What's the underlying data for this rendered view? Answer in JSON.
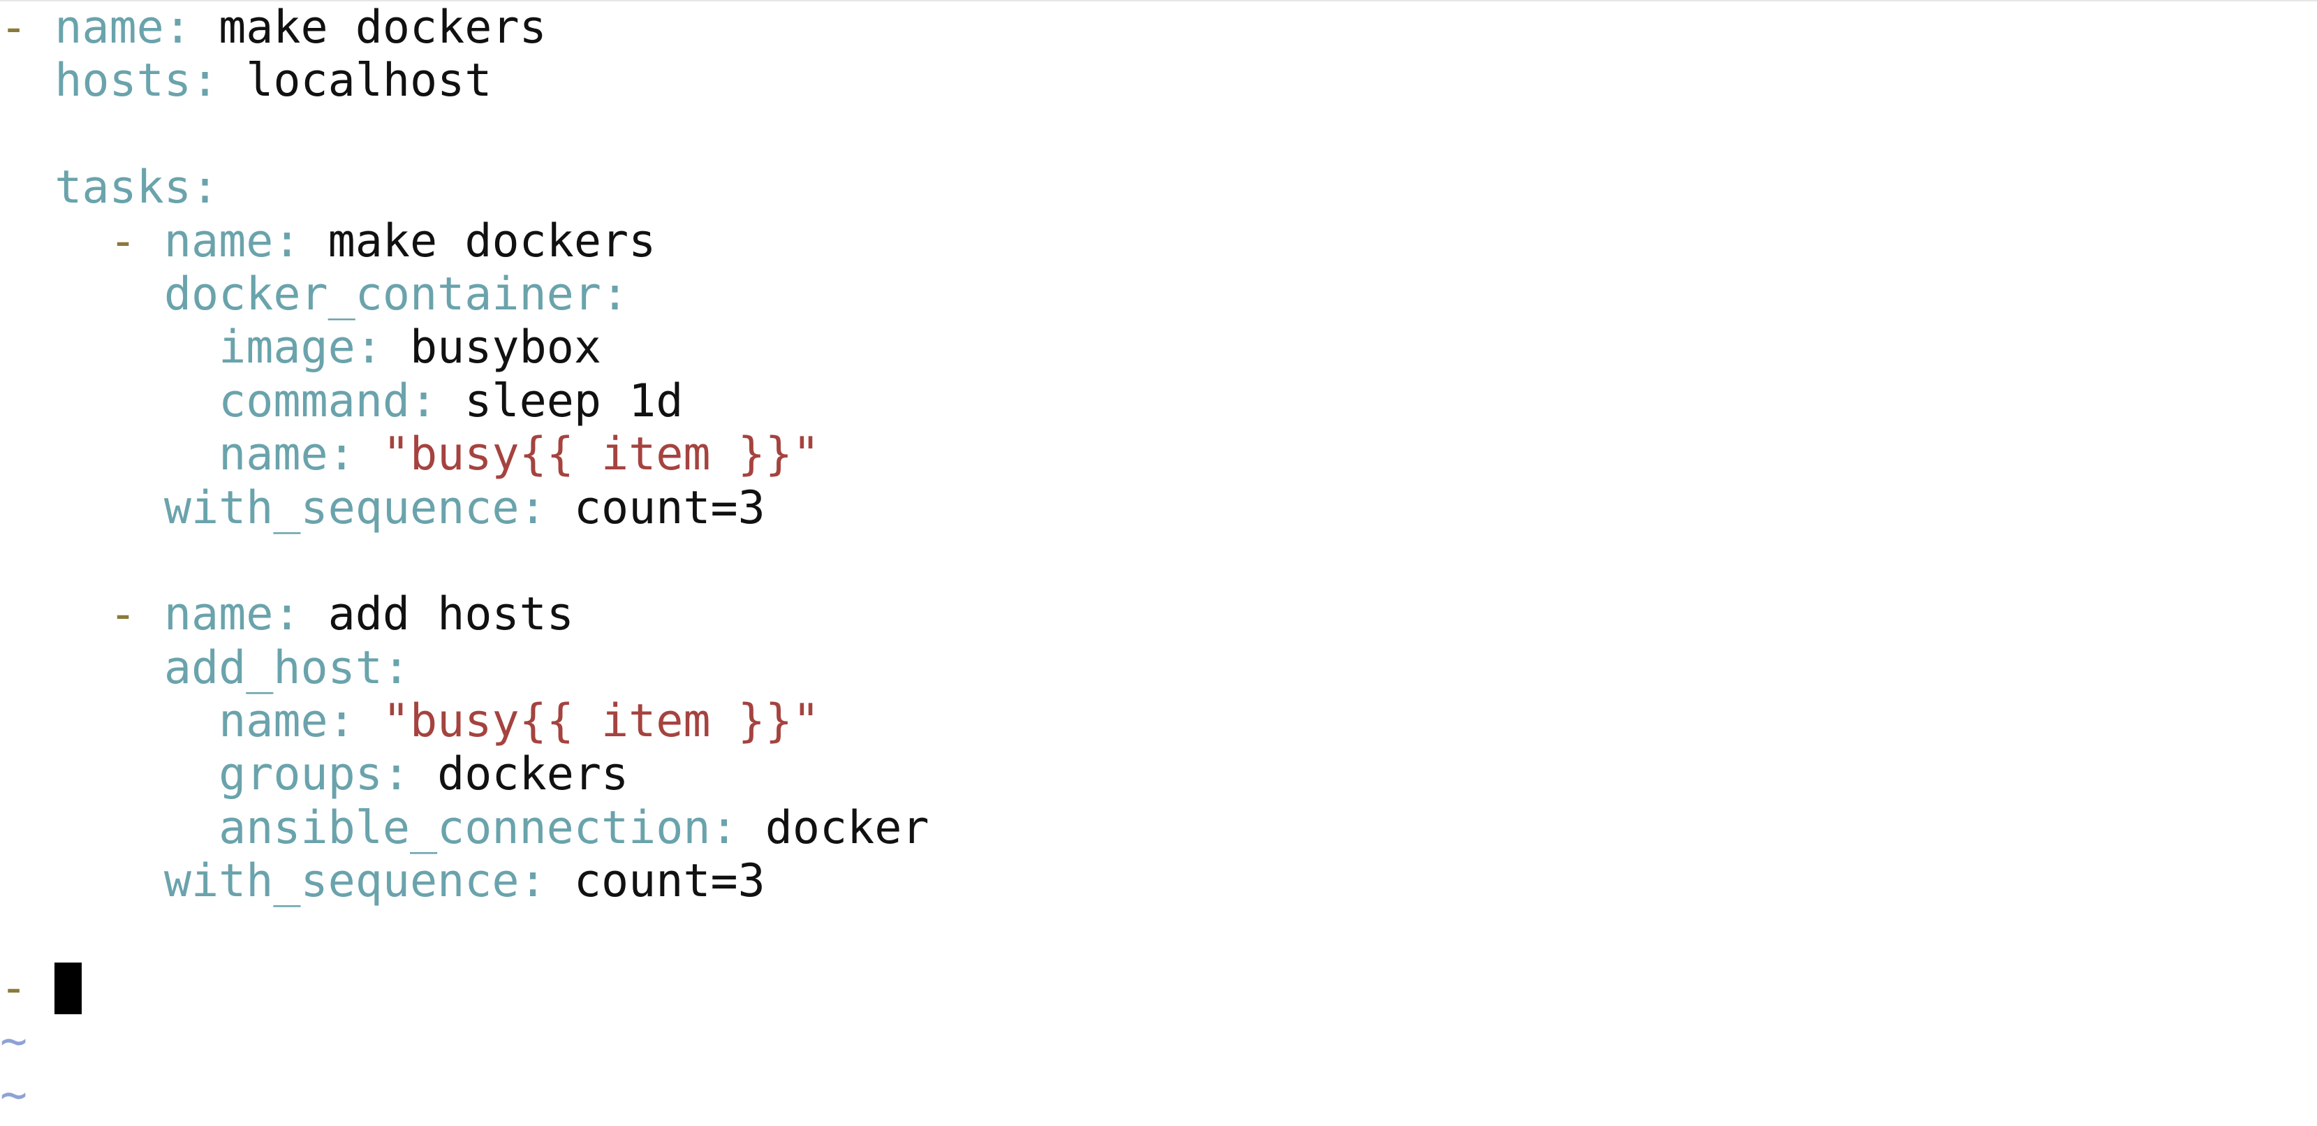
{
  "editor": {
    "lines": [
      {
        "indent": "",
        "dash": "- ",
        "key": "name",
        "value": "make dockers",
        "value_type": "plain"
      },
      {
        "indent": "  ",
        "dash": "",
        "key": "hosts",
        "value": "localhost",
        "value_type": "plain"
      },
      {
        "indent": "",
        "dash": "",
        "key": "",
        "value": "",
        "value_type": "blank"
      },
      {
        "indent": "  ",
        "dash": "",
        "key": "tasks",
        "value": "",
        "value_type": "plain"
      },
      {
        "indent": "    ",
        "dash": "- ",
        "key": "name",
        "value": "make dockers",
        "value_type": "plain"
      },
      {
        "indent": "      ",
        "dash": "",
        "key": "docker_container",
        "value": "",
        "value_type": "plain"
      },
      {
        "indent": "        ",
        "dash": "",
        "key": "image",
        "value": "busybox",
        "value_type": "plain"
      },
      {
        "indent": "        ",
        "dash": "",
        "key": "command",
        "value": "sleep 1d",
        "value_type": "plain"
      },
      {
        "indent": "        ",
        "dash": "",
        "key": "name",
        "value": "\"busy{{ item }}\"",
        "value_type": "string"
      },
      {
        "indent": "      ",
        "dash": "",
        "key": "with_sequence",
        "value": "count=3",
        "value_type": "plain"
      },
      {
        "indent": "",
        "dash": "",
        "key": "",
        "value": "",
        "value_type": "blank"
      },
      {
        "indent": "    ",
        "dash": "- ",
        "key": "name",
        "value": "add hosts",
        "value_type": "plain"
      },
      {
        "indent": "      ",
        "dash": "",
        "key": "add_host",
        "value": "",
        "value_type": "plain"
      },
      {
        "indent": "        ",
        "dash": "",
        "key": "name",
        "value": "\"busy{{ item }}\"",
        "value_type": "string"
      },
      {
        "indent": "        ",
        "dash": "",
        "key": "groups",
        "value": "dockers",
        "value_type": "plain"
      },
      {
        "indent": "        ",
        "dash": "",
        "key": "ansible_connection",
        "value": "docker",
        "value_type": "plain"
      },
      {
        "indent": "      ",
        "dash": "",
        "key": "with_sequence",
        "value": "count=3",
        "value_type": "plain"
      },
      {
        "indent": "",
        "dash": "",
        "key": "",
        "value": "",
        "value_type": "blank"
      }
    ],
    "cursor_line": {
      "dash": "- "
    },
    "empty_markers": [
      "~",
      "~"
    ]
  },
  "colors": {
    "key": "#6aa3ac",
    "dash": "#8a7a3a",
    "string": "#a5433f",
    "text": "#111111",
    "tilde": "#8ea2d4",
    "background": "#ffffff"
  }
}
